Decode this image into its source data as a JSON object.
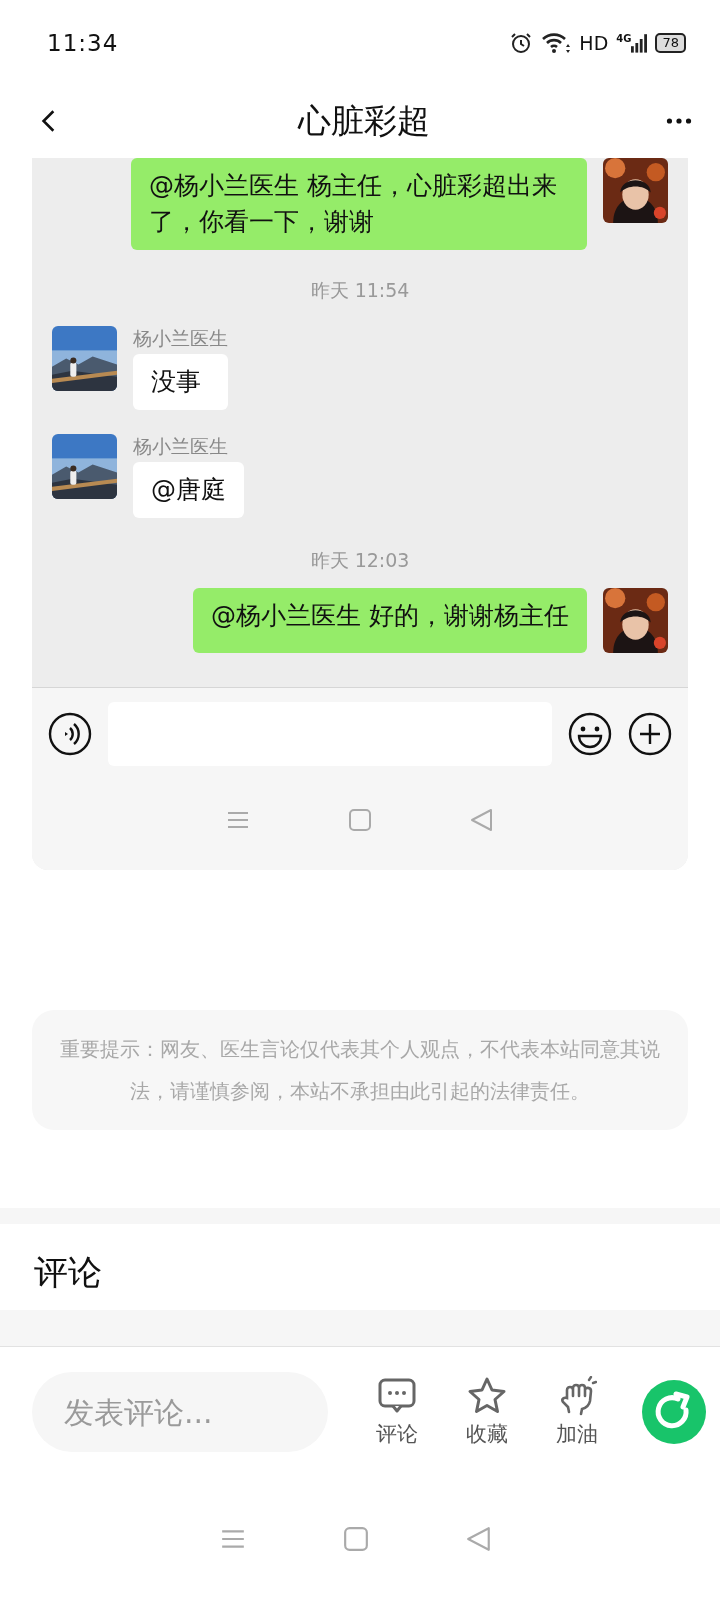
{
  "status_bar": {
    "time": "11:34",
    "hd": "HD",
    "network": "4G",
    "battery": "78"
  },
  "header": {
    "title": "心脏彩超"
  },
  "chat_screenshot": {
    "messages": [
      {
        "kind": "outgoing",
        "text": "@杨小兰医生  杨主任，心脏彩超出来了，你看一下，谢谢"
      },
      {
        "kind": "time",
        "text": "昨天 11:54"
      },
      {
        "kind": "incoming",
        "sender": "杨小兰医生",
        "text": "没事"
      },
      {
        "kind": "incoming",
        "sender": "杨小兰医生",
        "text": "@唐庭"
      },
      {
        "kind": "time",
        "text": "昨天 12:03"
      },
      {
        "kind": "outgoing",
        "text": "@杨小兰医生  好的，谢谢杨主任"
      }
    ]
  },
  "notice": "重要提示：网友、医生言论仅代表其个人观点，不代表本站同意其说法，请谨慎参阅，本站不承担由此引起的法律责任。",
  "comments": {
    "title": "评论"
  },
  "bottom_bar": {
    "placeholder": "发表评论...",
    "actions": [
      {
        "kind": "comment",
        "label": "评论"
      },
      {
        "kind": "star",
        "label": "收藏"
      },
      {
        "kind": "cheer",
        "label": "加油"
      }
    ]
  }
}
